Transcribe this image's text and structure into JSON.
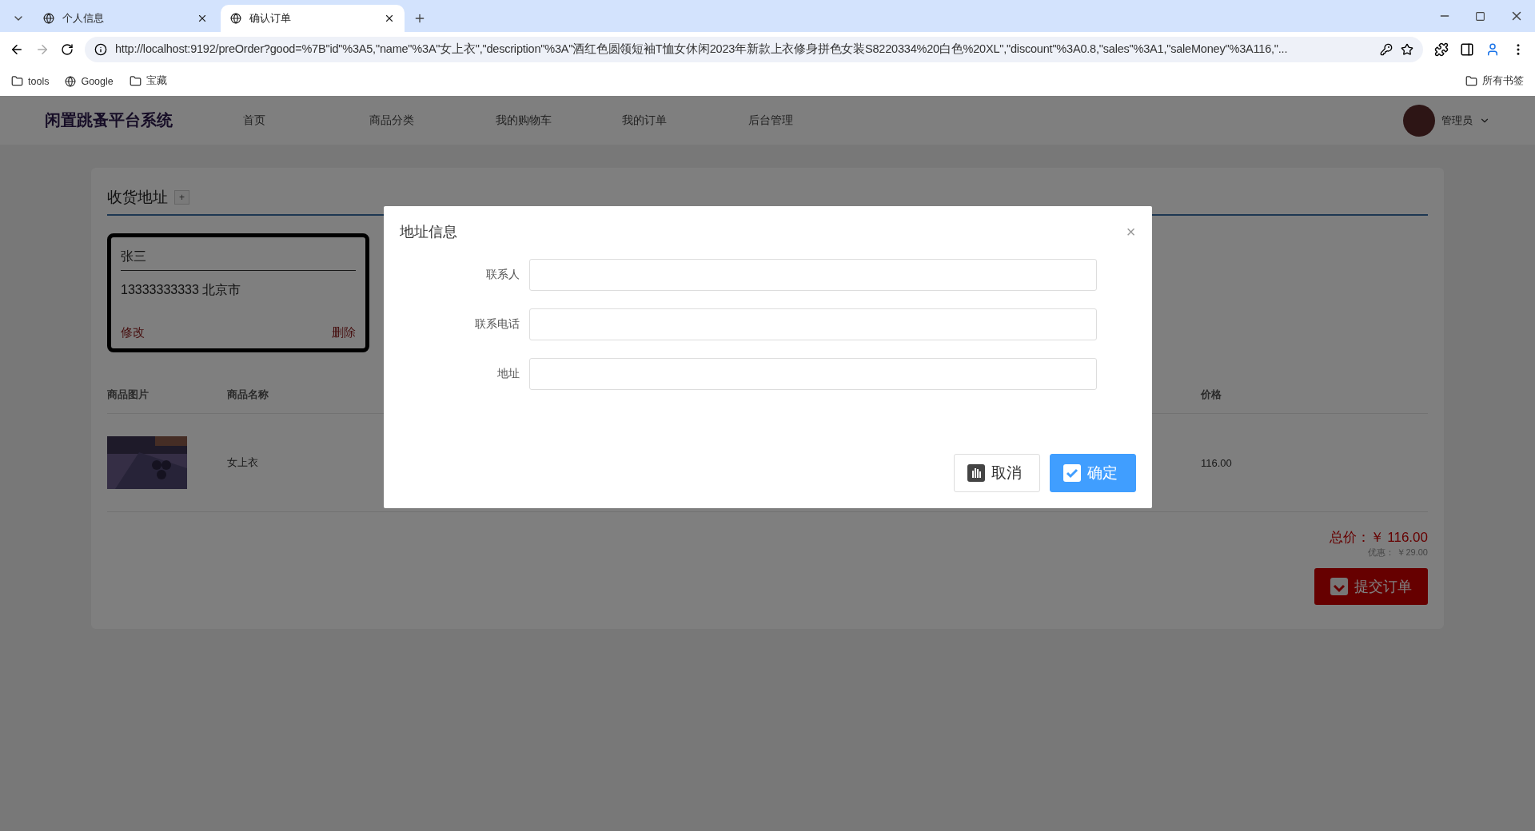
{
  "browser": {
    "tabs": [
      {
        "title": "个人信息",
        "selected": false
      },
      {
        "title": "确认订单",
        "selected": true
      }
    ],
    "url": "http://localhost:9192/preOrder?good=%7B\"id\"%3A5,\"name\"%3A\"女上衣\",\"description\"%3A\"酒红色圆领短袖T恤女休闲2023年新款上衣修身拼色女装S8220334%20白色%20XL\",\"discount\"%3A0.8,\"sales\"%3A1,\"saleMoney\"%3A116,\"...",
    "bookmarks": [
      {
        "label": "tools",
        "kind": "folder"
      },
      {
        "label": "Google",
        "kind": "site"
      },
      {
        "label": "宝藏",
        "kind": "folder"
      }
    ],
    "all_bookmarks": "所有书签"
  },
  "site": {
    "brand": "闲置跳蚤平台系统",
    "nav": [
      "首页",
      "商品分类",
      "我的购物车",
      "我的订单",
      "后台管理"
    ],
    "user": "管理员"
  },
  "address_section": {
    "title": "收货地址",
    "add": "+",
    "addresses": [
      {
        "name": "张三",
        "detail": "13333333333 北京市",
        "edit": "修改",
        "delete": "删除",
        "selected": true
      }
    ]
  },
  "table": {
    "columns": [
      "商品图片",
      "商品名称",
      "价格"
    ],
    "rows": [
      {
        "name": "女上衣",
        "price": "116.00"
      }
    ]
  },
  "summary": {
    "total": "总价：￥ 116.00",
    "discount": "优惠： ￥29.00",
    "submit": "提交订单"
  },
  "dialog": {
    "title": "地址信息",
    "close": "×",
    "fields": [
      {
        "label": "联系人"
      },
      {
        "label": "联系电话"
      },
      {
        "label": "地址"
      }
    ],
    "buttons": [
      {
        "label": "取消",
        "kind": "cancel"
      },
      {
        "label": "确定",
        "kind": "primary"
      }
    ]
  }
}
